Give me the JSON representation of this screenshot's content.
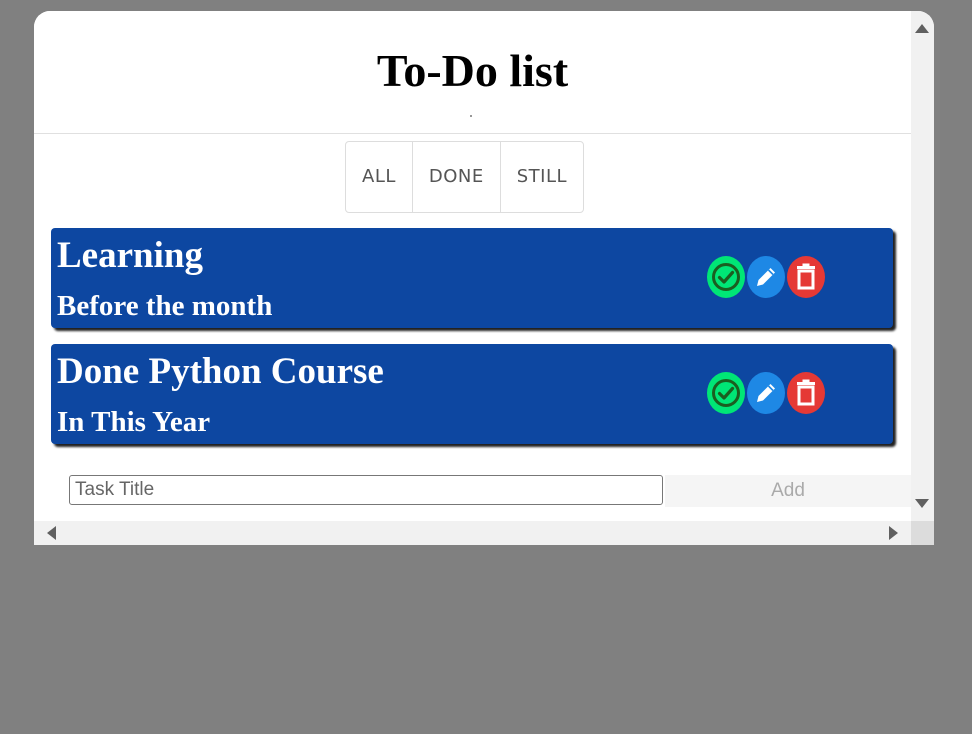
{
  "header": {
    "title": "To-Do list"
  },
  "filters": [
    {
      "label": "ALL"
    },
    {
      "label": "DONE"
    },
    {
      "label": "STILL"
    }
  ],
  "tasks": [
    {
      "title": "Learning",
      "subtitle": "Before the month"
    },
    {
      "title": "Done Python Course",
      "subtitle": "In This Year"
    }
  ],
  "add_form": {
    "placeholder": "Task Title",
    "button_label": "Add"
  },
  "icons": {
    "done": "check-icon",
    "edit": "pencil-icon",
    "delete": "trash-icon"
  },
  "colors": {
    "task_bg": "#0d47a1",
    "done": "#00e676",
    "edit": "#1e88e5",
    "delete": "#e53935",
    "backdrop": "#808080"
  }
}
